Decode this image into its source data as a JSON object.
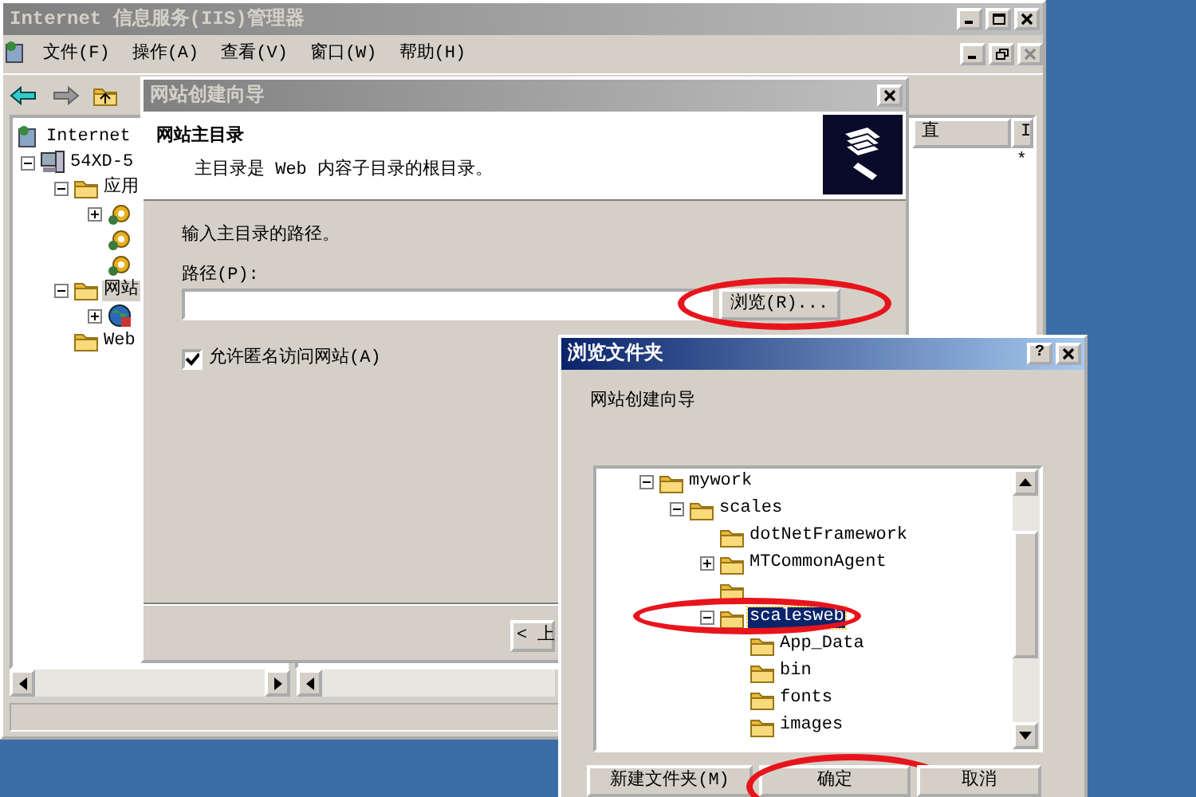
{
  "main_window": {
    "title": "Internet 信息服务(IIS)管理器",
    "active": false,
    "menu": [
      "文件(F)",
      "操作(A)",
      "查看(V)",
      "窗口(W)",
      "帮助(H)"
    ],
    "tree": [
      {
        "label": "Internet",
        "kind": "iis",
        "selected": false,
        "children": [
          {
            "label": "54XD-5",
            "kind": "computer",
            "expanded": true,
            "selected": false,
            "children": [
              {
                "label": "应用",
                "expanded": true,
                "selected": false,
                "children": [
                  {
                    "kind": "app-pool",
                    "expanded": false,
                    "selected": false
                  },
                  {
                    "kind": "app-pool",
                    "selected": false
                  },
                  {
                    "kind": "app-pool",
                    "selected": false
                  }
                ]
              },
              {
                "label": "网站",
                "expanded": true,
                "selected": true,
                "children": [
                  {
                    "kind": "globe",
                    "expanded": false,
                    "selected": false
                  }
                ]
              },
              {
                "label": "Web",
                "selected": false
              }
            ]
          }
        ]
      }
    ],
    "list_columns": [
      "直",
      "I"
    ],
    "list_rows": [
      "*"
    ]
  },
  "wizard": {
    "title": "网站创建向导",
    "active": false,
    "header_title": "网站主目录",
    "header_subtitle": "主目录是 Web 内容子目录的根目录。",
    "prompt": "输入主目录的路径。",
    "path_label": "路径(P):",
    "browse_button": {
      "label": "浏览(R)...",
      "circled": true
    },
    "anonymous_checkbox": {
      "label": "允许匿名访问网站(A)",
      "checked": true
    },
    "back_button": "< 上"
  },
  "browse_dialog": {
    "title": "浏览文件夹",
    "active": true,
    "help_button": "?",
    "description": "网站创建向导",
    "folders": [
      {
        "label": "mywork",
        "expanded": true,
        "selected": false,
        "children": [
          {
            "label": "scales",
            "expanded": true,
            "selected": false,
            "children": [
              {
                "label": "dotNetFramework",
                "selected": false
              },
              {
                "label": "MTCommonAgent",
                "expanded": false,
                "selected": false
              },
              {
                "selected": false
              },
              {
                "label": "scalesweb",
                "expanded": true,
                "selected": true,
                "circled": true,
                "children": [
                  {
                    "label": "App_Data",
                    "selected": false
                  },
                  {
                    "label": "bin",
                    "selected": false
                  },
                  {
                    "label": "fonts",
                    "selected": false
                  },
                  {
                    "label": "images",
                    "selected": false
                  }
                ]
              }
            ]
          }
        ]
      }
    ],
    "buttons": [
      {
        "label": "新建文件夹(M)",
        "circled": false
      },
      {
        "label": "确定",
        "circled": true
      },
      {
        "label": "取消",
        "circled": false
      }
    ]
  }
}
